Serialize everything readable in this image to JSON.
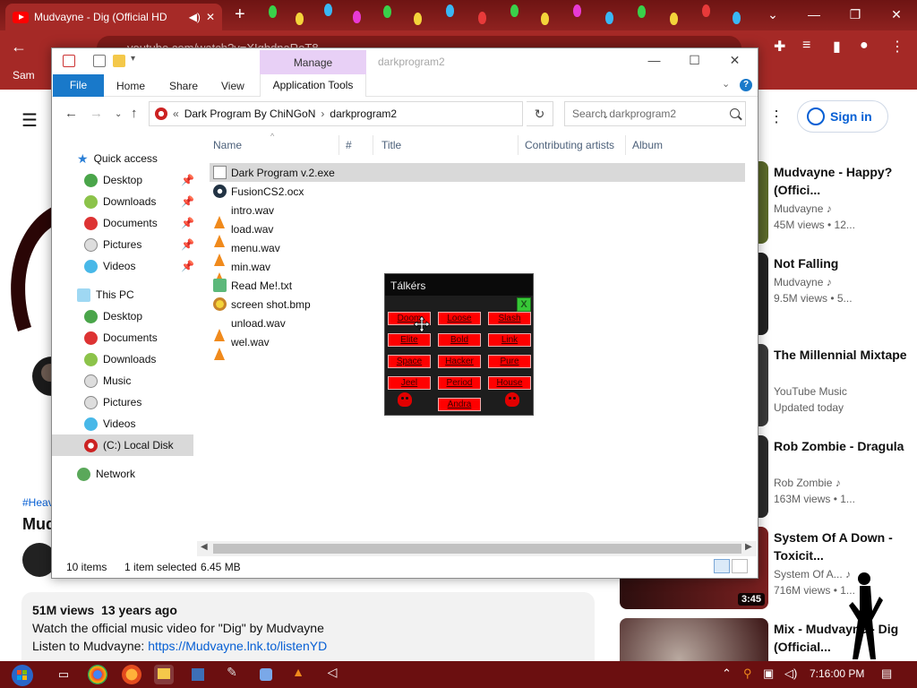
{
  "browser": {
    "tab_title": "Mudvayne - Dig (Official HD",
    "url": "youtube.com/watch?v=XIgbdnaRoT8",
    "bookmark": "Sam",
    "new_tab": "+"
  },
  "youtube": {
    "sign_in": "Sign in",
    "hashtag": "#Heav",
    "video_title_partial": "Mud",
    "views": "51M views",
    "age": "13 years ago",
    "desc_line1": "Watch the official music video for \"Dig\" by Mudvayne",
    "desc_line2_prefix": "Listen to Mudvayne: ",
    "desc_link": "https://Mudvayne.lnk.to/listenYD",
    "related": [
      {
        "title": "Mudvayne - Happy? (Offici...",
        "channel": "Mudvayne",
        "meta": "45M views • 12...",
        "duration": ""
      },
      {
        "title": "Not Falling",
        "channel": "Mudvayne",
        "meta": "9.5M views • 5...",
        "duration": ""
      },
      {
        "title": "The Millennial Mixtape",
        "channel": "YouTube Music",
        "meta": "Updated today",
        "duration": ""
      },
      {
        "title": "Rob Zombie - Dragula",
        "channel": "Rob Zombie",
        "meta": "163M views • 1...",
        "duration": ""
      },
      {
        "title": "System Of A Down - Toxicit...",
        "channel": "System Of A...",
        "meta": "716M views • 1...",
        "duration": "3:45"
      },
      {
        "title": "Mix - Mudvayne - Dig (Official...",
        "channel": "",
        "meta": "",
        "duration": ""
      }
    ]
  },
  "explorer": {
    "title": "darkprogram2",
    "manage": "Manage",
    "ribbon": {
      "file": "File",
      "home": "Home",
      "share": "Share",
      "view": "View",
      "app_tools": "Application Tools"
    },
    "breadcrumb": {
      "prefix": "«",
      "parent": "Dark Program By ChiNGoN",
      "current": "darkprogram2"
    },
    "search_placeholder": "Search darkprogram2",
    "sidebar": {
      "quick_access": "Quick access",
      "qa_items": [
        "Desktop",
        "Downloads",
        "Documents",
        "Pictures",
        "Videos"
      ],
      "this_pc": "This PC",
      "pc_items": [
        "Desktop",
        "Documents",
        "Downloads",
        "Music",
        "Pictures",
        "Videos",
        "(C:) Local Disk"
      ],
      "network": "Network"
    },
    "columns": {
      "name": "Name",
      "num": "#",
      "title": "Title",
      "artists": "Contributing artists",
      "album": "Album"
    },
    "files": [
      {
        "name": "Dark Program v.2.exe",
        "icon": "exe-skull-icon"
      },
      {
        "name": "FusionCS2.ocx",
        "icon": "ocx-gear-icon"
      },
      {
        "name": "intro.wav",
        "icon": "vlc-cone-icon"
      },
      {
        "name": "load.wav",
        "icon": "vlc-cone-icon"
      },
      {
        "name": "menu.wav",
        "icon": "vlc-cone-icon"
      },
      {
        "name": "min.wav",
        "icon": "vlc-cone-icon"
      },
      {
        "name": "Read Me!.txt",
        "icon": "notepad-icon"
      },
      {
        "name": "screen shot.bmp",
        "icon": "paint-icon"
      },
      {
        "name": "unload.wav",
        "icon": "vlc-cone-icon"
      },
      {
        "name": "wel.wav",
        "icon": "vlc-cone-icon"
      }
    ],
    "status": {
      "count": "10 items",
      "selected": "1 item selected",
      "size": "6.45 MB"
    }
  },
  "dark_program": {
    "title": "Tálkérs",
    "close": "X",
    "buttons": [
      [
        "Doom",
        "Loose",
        "Slash"
      ],
      [
        "Elite",
        "Bold",
        "Link"
      ],
      [
        "Space",
        "Hacker",
        "Pure"
      ],
      [
        "Jeel",
        "Period",
        "House"
      ]
    ],
    "bottom_button": "Andra"
  },
  "taskbar": {
    "time": "7:16:00 PM",
    "tray_icons": [
      "up-chevron-icon",
      "search-tray-icon",
      "network-icon",
      "volume-icon"
    ]
  },
  "colors": {
    "chrome_red": "#a52926",
    "explorer_blue": "#1979ca",
    "manage_purple": "#e8d0f6",
    "dark_red": "#ff0000",
    "taskbar": "#6b0f10"
  }
}
